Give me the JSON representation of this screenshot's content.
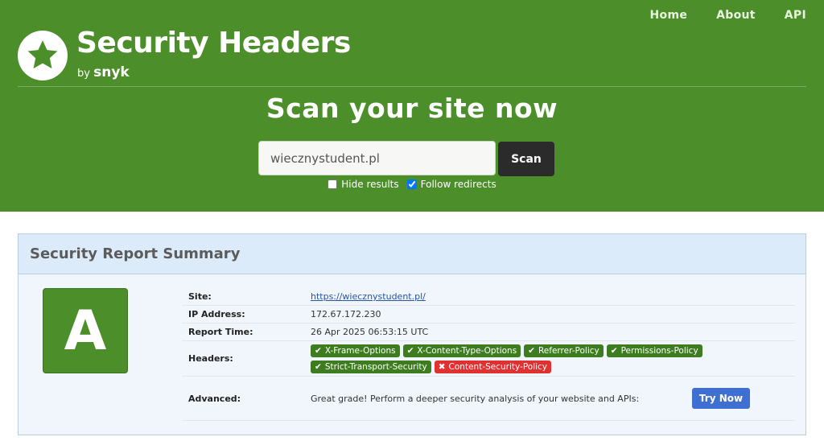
{
  "nav": {
    "home": "Home",
    "about": "About",
    "api": "API"
  },
  "brand": {
    "title": "Security Headers",
    "by": "by",
    "company": "snyk"
  },
  "scan": {
    "title": "Scan your site now",
    "input_value": "wiecznystudent.pl",
    "button": "Scan",
    "hide_results": "Hide results",
    "hide_results_checked": false,
    "follow_redirects": "Follow redirects",
    "follow_redirects_checked": true
  },
  "report": {
    "title": "Security Report Summary",
    "grade": "A",
    "rows": {
      "site_label": "Site:",
      "site_value": "https://wiecznystudent.pl/",
      "ip_label": "IP Address:",
      "ip_value": "172.67.172.230",
      "time_label": "Report Time:",
      "time_value": "26 Apr 2025 06:53:15 UTC",
      "headers_label": "Headers:",
      "advanced_label": "Advanced:",
      "advanced_text": "Great grade! Perform a deeper security analysis of your website and APIs:",
      "try_now": "Try Now"
    },
    "headers": [
      {
        "name": "X-Frame-Options",
        "status": "ok"
      },
      {
        "name": "X-Content-Type-Options",
        "status": "ok"
      },
      {
        "name": "Referrer-Policy",
        "status": "ok"
      },
      {
        "name": "Permissions-Policy",
        "status": "ok"
      },
      {
        "name": "Strict-Transport-Security",
        "status": "ok"
      },
      {
        "name": "Content-Security-Policy",
        "status": "missing"
      }
    ]
  },
  "colors": {
    "brand_green": "#4c8f2a",
    "ok": "#3d7d20",
    "missing": "#e03030",
    "accent": "#3f6fd0"
  },
  "icons": {
    "logo": "star-icon",
    "ok": "check-icon",
    "missing": "cross-icon"
  }
}
